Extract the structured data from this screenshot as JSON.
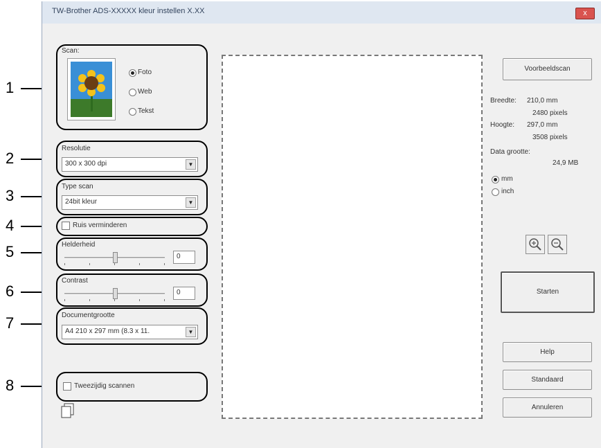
{
  "window": {
    "title": "TW-Brother ADS-XXXXX kleur instellen X.XX",
    "close_label": "x"
  },
  "callouts": [
    "1",
    "2",
    "3",
    "4",
    "5",
    "6",
    "7",
    "8"
  ],
  "scan": {
    "group_label": "Scan:",
    "options": [
      {
        "label": "Foto",
        "selected": true
      },
      {
        "label": "Web",
        "selected": false
      },
      {
        "label": "Tekst",
        "selected": false
      }
    ]
  },
  "resolution": {
    "label": "Resolutie",
    "value": "300 x 300 dpi"
  },
  "scan_type": {
    "label": "Type scan",
    "value": "24bit kleur"
  },
  "noise": {
    "label": "Ruis verminderen",
    "checked": false
  },
  "brightness": {
    "label": "Helderheid",
    "value": "0"
  },
  "contrast": {
    "label": "Contrast",
    "value": "0"
  },
  "doc_size": {
    "label": "Documentgrootte",
    "value": "A4 210 x 297 mm (8.3 x 11."
  },
  "duplex": {
    "label": "Tweezijdig scannen",
    "checked": false
  },
  "right_panel": {
    "preview_button": "Voorbeeldscan",
    "width_label": "Breedte:",
    "width_mm": "210,0 mm",
    "width_px": "2480 pixels",
    "height_label": "Hoogte:",
    "height_mm": "297,0 mm",
    "height_px": "3508 pixels",
    "data_size_label": "Data grootte:",
    "data_size_value": "24,9 MB",
    "units": [
      {
        "label": "mm",
        "selected": true
      },
      {
        "label": "inch",
        "selected": false
      }
    ],
    "start_button": "Starten",
    "help_button": "Help",
    "default_button": "Standaard",
    "cancel_button": "Annuleren"
  }
}
